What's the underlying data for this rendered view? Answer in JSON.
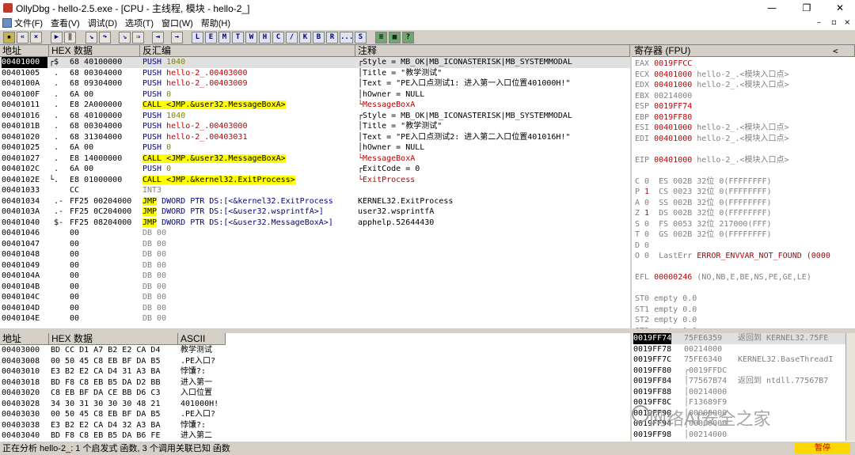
{
  "window": {
    "title": "OllyDbg - hello-2.5.exe - [CPU - 主线程, 模块 - hello-2_]",
    "controls": [
      "—",
      "❐",
      "✕"
    ]
  },
  "menu": [
    "文件(F)",
    "查看(V)",
    "调试(D)",
    "选项(T)",
    "窗口(W)",
    "帮助(H)"
  ],
  "toolbar": {
    "letters": [
      "L",
      "E",
      "M",
      "T",
      "W",
      "H",
      "C",
      "/",
      "K",
      "B",
      "R",
      "...",
      "S"
    ]
  },
  "disasm": {
    "headers": [
      "地址",
      "HEX 数据",
      "反汇编",
      "注释"
    ],
    "rows": [
      {
        "addr": "00401000",
        "mark": "┌$",
        "hex": "68 40100000",
        "asm": [
          [
            "PUSH ",
            "navy"
          ],
          [
            "1040",
            "olive"
          ]
        ],
        "cmt": [
          [
            "┌Style = MB_OK|MB_ICONASTERISK|MB_SYSTEMMODAL",
            ""
          ]
        ],
        "sel": true
      },
      {
        "addr": "00401005",
        "mark": " .",
        "hex": "68 00304000",
        "asm": [
          [
            "PUSH ",
            "navy"
          ],
          [
            "hello-2_.00403000",
            "red"
          ]
        ],
        "cmt": [
          [
            "│Title = \"教学测试\"",
            ""
          ]
        ]
      },
      {
        "addr": "0040100A",
        "mark": " .",
        "hex": "68 09304000",
        "asm": [
          [
            "PUSH ",
            "navy"
          ],
          [
            "hello-2_.00403009",
            "red"
          ]
        ],
        "cmt": [
          [
            "│Text = \"PE入口点测试1: 进入第一入口位置401000H!\"",
            ""
          ]
        ]
      },
      {
        "addr": "0040100F",
        "mark": " .",
        "hex": "6A 00",
        "asm": [
          [
            "PUSH ",
            "navy"
          ],
          [
            "0",
            "olive"
          ]
        ],
        "cmt": [
          [
            "│hOwner = NULL",
            ""
          ]
        ]
      },
      {
        "addr": "00401011",
        "mark": " .",
        "hex": "E8 2A000000",
        "asm": [
          [
            "CALL",
            "callb"
          ],
          [
            " <JMP.&user32.MessageBoxA>",
            "jmp"
          ]
        ],
        "cmt": [
          [
            "└MessageBoxA",
            "red"
          ]
        ]
      },
      {
        "addr": "00401016",
        "mark": " .",
        "hex": "68 40100000",
        "asm": [
          [
            "PUSH ",
            "navy"
          ],
          [
            "1040",
            "olive"
          ]
        ],
        "cmt": [
          [
            "┌Style = MB_OK|MB_ICONASTERISK|MB_SYSTEMMODAL",
            ""
          ]
        ]
      },
      {
        "addr": "0040101B",
        "mark": " .",
        "hex": "68 00304000",
        "asm": [
          [
            "PUSH ",
            "navy"
          ],
          [
            "hello-2_.00403000",
            "red"
          ]
        ],
        "cmt": [
          [
            "│Title = \"教学测试\"",
            ""
          ]
        ]
      },
      {
        "addr": "00401020",
        "mark": " .",
        "hex": "68 31304000",
        "asm": [
          [
            "PUSH ",
            "navy"
          ],
          [
            "hello-2_.00403031",
            "red"
          ]
        ],
        "cmt": [
          [
            "│Text = \"PE入口点测试2: 进入第二入口位置401016H!\"",
            ""
          ]
        ]
      },
      {
        "addr": "00401025",
        "mark": " .",
        "hex": "6A 00",
        "asm": [
          [
            "PUSH ",
            "navy"
          ],
          [
            "0",
            "olive"
          ]
        ],
        "cmt": [
          [
            "│hOwner = NULL",
            ""
          ]
        ]
      },
      {
        "addr": "00401027",
        "mark": " .",
        "hex": "E8 14000000",
        "asm": [
          [
            "CALL",
            "callb"
          ],
          [
            " <JMP.&user32.MessageBoxA>",
            "jmp"
          ]
        ],
        "cmt": [
          [
            "└MessageBoxA",
            "red"
          ]
        ]
      },
      {
        "addr": "0040102C",
        "mark": " .",
        "hex": "6A 00",
        "asm": [
          [
            "PUSH ",
            "navy"
          ],
          [
            "0",
            "olive"
          ]
        ],
        "cmt": [
          [
            "┌ExitCode = 0",
            ""
          ]
        ]
      },
      {
        "addr": "0040102E",
        "mark": "└.",
        "hex": "E8 01000000",
        "asm": [
          [
            "CALL",
            "callb"
          ],
          [
            " <JMP.&kernel32.ExitProcess>",
            "jmp"
          ]
        ],
        "cmt": [
          [
            "└ExitProcess",
            "red"
          ]
        ]
      },
      {
        "addr": "00401033",
        "mark": "  ",
        "hex": "CC",
        "asm": [
          [
            "INT3",
            "gray"
          ]
        ],
        "cmt": []
      },
      {
        "addr": "00401034",
        "mark": " .-",
        "hex": "FF25 00204000",
        "asm": [
          [
            "JMP",
            "jmp"
          ],
          [
            " DWORD PTR DS:[<&kernel32.ExitProcess",
            "navy"
          ]
        ],
        "cmt": [
          [
            "KERNEL32.ExitProcess",
            ""
          ]
        ]
      },
      {
        "addr": "0040103A",
        "mark": " .-",
        "hex": "FF25 0C204000",
        "asm": [
          [
            "JMP",
            "jmp"
          ],
          [
            " DWORD PTR DS:[<&user32.wsprintfA>]",
            "navy"
          ]
        ],
        "cmt": [
          [
            "user32.wsprintfA",
            ""
          ]
        ]
      },
      {
        "addr": "00401040",
        "mark": " $-",
        "hex": "FF25 08204000",
        "asm": [
          [
            "JMP",
            "jmp"
          ],
          [
            " DWORD PTR DS:[<&user32.MessageBoxA>]",
            "navy"
          ]
        ],
        "cmt": [
          [
            "apphelp.52644430",
            ""
          ]
        ]
      },
      {
        "addr": "00401046",
        "mark": "  ",
        "hex": "00",
        "asm": [
          [
            "DB 00",
            "gray"
          ]
        ],
        "cmt": []
      },
      {
        "addr": "00401047",
        "mark": "  ",
        "hex": "00",
        "asm": [
          [
            "DB 00",
            "gray"
          ]
        ],
        "cmt": []
      },
      {
        "addr": "00401048",
        "mark": "  ",
        "hex": "00",
        "asm": [
          [
            "DB 00",
            "gray"
          ]
        ],
        "cmt": []
      },
      {
        "addr": "00401049",
        "mark": "  ",
        "hex": "00",
        "asm": [
          [
            "DB 00",
            "gray"
          ]
        ],
        "cmt": []
      },
      {
        "addr": "0040104A",
        "mark": "  ",
        "hex": "00",
        "asm": [
          [
            "DB 00",
            "gray"
          ]
        ],
        "cmt": []
      },
      {
        "addr": "0040104B",
        "mark": "  ",
        "hex": "00",
        "asm": [
          [
            "DB 00",
            "gray"
          ]
        ],
        "cmt": []
      },
      {
        "addr": "0040104C",
        "mark": "  ",
        "hex": "00",
        "asm": [
          [
            "DB 00",
            "gray"
          ]
        ],
        "cmt": []
      },
      {
        "addr": "0040104D",
        "mark": "  ",
        "hex": "00",
        "asm": [
          [
            "DB 00",
            "gray"
          ]
        ],
        "cmt": []
      },
      {
        "addr": "0040104E",
        "mark": "  ",
        "hex": "00",
        "asm": [
          [
            "DB 00",
            "gray"
          ]
        ],
        "cmt": []
      }
    ]
  },
  "registers": {
    "header": "寄存器 (FPU)",
    "lines": [
      [
        [
          "EAX ",
          "gray"
        ],
        [
          "0019FFCC",
          "red"
        ]
      ],
      [
        [
          "ECX ",
          "gray"
        ],
        [
          "00401000",
          "red"
        ],
        [
          " hello-2_.<模块入口点>",
          "gray"
        ]
      ],
      [
        [
          "EDX ",
          "gray"
        ],
        [
          "00401000",
          "red"
        ],
        [
          " hello-2_.<模块入口点>",
          "gray"
        ]
      ],
      [
        [
          "EBX ",
          "gray"
        ],
        [
          "00214000",
          "gray"
        ]
      ],
      [
        [
          "ESP ",
          "gray"
        ],
        [
          "0019FF74",
          "red"
        ]
      ],
      [
        [
          "EBP ",
          "gray"
        ],
        [
          "0019FF80",
          "red"
        ]
      ],
      [
        [
          "ESI ",
          "gray"
        ],
        [
          "00401000",
          "red"
        ],
        [
          " hello-2_.<模块入口点>",
          "gray"
        ]
      ],
      [
        [
          "EDI ",
          "gray"
        ],
        [
          "00401000",
          "red"
        ],
        [
          " hello-2_.<模块入口点>",
          "gray"
        ]
      ],
      [
        [
          "",
          ""
        ]
      ],
      [
        [
          "EIP ",
          "gray"
        ],
        [
          "00401000",
          "red"
        ],
        [
          " hello-2_.<模块入口点>",
          "gray"
        ]
      ],
      [
        [
          "",
          ""
        ]
      ],
      [
        [
          "C 0  ES 002B 32位 0(FFFFFFFF)",
          "gray"
        ]
      ],
      [
        [
          "P ",
          "gray"
        ],
        [
          "1",
          "red"
        ],
        [
          "  CS 0023 32位 0(FFFFFFFF)",
          "gray"
        ]
      ],
      [
        [
          "A 0  SS 002B 32位 0(FFFFFFFF)",
          "gray"
        ]
      ],
      [
        [
          "Z ",
          "gray"
        ],
        [
          "1",
          "red"
        ],
        [
          "  DS 002B 32位 0(FFFFFFFF)",
          "gray"
        ]
      ],
      [
        [
          "S 0  FS 0053 32位 217000(FFF)",
          "gray"
        ]
      ],
      [
        [
          "T 0  GS 002B 32位 0(FFFFFFFF)",
          "gray"
        ]
      ],
      [
        [
          "D 0",
          "gray"
        ]
      ],
      [
        [
          "O 0  LastErr ",
          "gray"
        ],
        [
          "ERROR_ENVVAR_NOT_FOUND (0000",
          "red"
        ]
      ],
      [
        [
          "",
          ""
        ]
      ],
      [
        [
          "EFL ",
          "gray"
        ],
        [
          "00000246",
          "red"
        ],
        [
          " (NO,NB,E,BE,NS,PE,GE,LE)",
          "gray"
        ]
      ],
      [
        [
          "",
          ""
        ]
      ],
      [
        [
          "ST0 empty 0.0",
          "gray"
        ]
      ],
      [
        [
          "ST1 empty 0.0",
          "gray"
        ]
      ],
      [
        [
          "ST2 empty 0.0",
          "gray"
        ]
      ],
      [
        [
          "ST3 empty 0.0",
          "gray"
        ]
      ],
      [
        [
          "ST4 empty 0.0",
          "gray"
        ]
      ],
      [
        [
          "ST5 empty 0.0",
          "gray"
        ]
      ]
    ]
  },
  "dump": {
    "headers": [
      "地址",
      "HEX 数据",
      "ASCII"
    ],
    "rows": [
      {
        "addr": "00403000",
        "hex": "BD CC D1 A7 B2 E2 CA D4",
        "ascii": "教学测试"
      },
      {
        "addr": "00403008",
        "hex": "00 50 45 C8 EB BF DA B5",
        "ascii": ".PE入口?"
      },
      {
        "addr": "00403010",
        "hex": "E3 B2 E2 CA D4 31 A3 BA",
        "ascii": "悖馕?:"
      },
      {
        "addr": "00403018",
        "hex": "BD F8 C8 EB B5 DA D2 BB",
        "ascii": "进入第一"
      },
      {
        "addr": "00403020",
        "hex": "C8 EB BF DA CE BB D6 C3",
        "ascii": "入口位置"
      },
      {
        "addr": "00403028",
        "hex": "34 30 31 30 30 30 48 21",
        "ascii": "401000H!"
      },
      {
        "addr": "00403030",
        "hex": "00 50 45 C8 EB BF DA B5",
        "ascii": ".PE入口?"
      },
      {
        "addr": "00403038",
        "hex": "E3 B2 E2 CA D4 32 A3 BA",
        "ascii": "悖馕?:"
      },
      {
        "addr": "00403040",
        "hex": "BD F8 C8 EB B5 DA B6 FE",
        "ascii": "进入第二"
      }
    ]
  },
  "stack": {
    "rows": [
      {
        "addr": "0019FF74",
        "val": "75FE6359",
        "cmt": "返回到 KERNEL32.75FE",
        "sel": true
      },
      {
        "addr": "0019FF78",
        "val": "00214000",
        "cmt": ""
      },
      {
        "addr": "0019FF7C",
        "val": "75FE6340",
        "cmt": "KERNEL32.BaseThreadI"
      },
      {
        "addr": "0019FF80",
        "val": "┌0019FFDC",
        "cmt": ""
      },
      {
        "addr": "0019FF84",
        "val": "│77567B74",
        "cmt": "返回到 ntdll.77567B7"
      },
      {
        "addr": "0019FF88",
        "val": "│00214000",
        "cmt": ""
      },
      {
        "addr": "0019FF8C",
        "val": "│F13689F9",
        "cmt": ""
      },
      {
        "addr": "0019FF90",
        "val": "│00000000",
        "cmt": ""
      },
      {
        "addr": "0019FF94",
        "val": "│00000000",
        "cmt": ""
      },
      {
        "addr": "0019FF98",
        "val": "│00214000",
        "cmt": ""
      }
    ]
  },
  "status": {
    "text": "正在分析 hello-2_: 1 个启发式 函数, 3 个调用关联已知 函数",
    "paused": "暂停"
  },
  "watermark": "网络AI安全之家"
}
